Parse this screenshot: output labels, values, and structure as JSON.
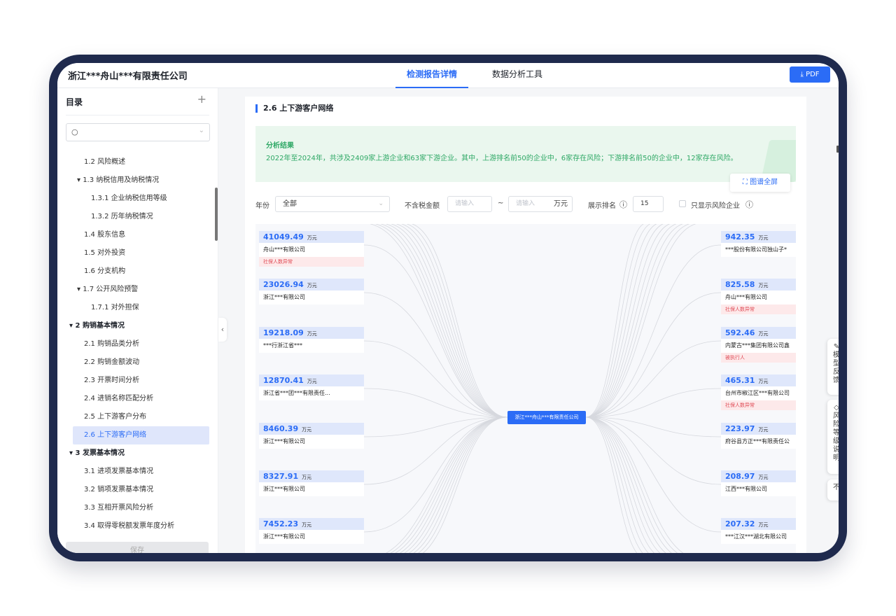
{
  "header": {
    "company": "浙江***舟山***有限责任公司",
    "tabs": [
      {
        "label": "检测报告详情",
        "active": true
      },
      {
        "label": "数据分析工具",
        "active": false
      }
    ],
    "pdf_label": "PDF"
  },
  "sidebar": {
    "title": "目录",
    "add_icon": "+",
    "items": [
      {
        "label": "1.2 风险概述"
      },
      {
        "label": "▾ 1.3 纳税信用及纳税情况"
      },
      {
        "label": "1.3.1 企业纳税信用等级"
      },
      {
        "label": "1.3.2 历年纳税情况"
      },
      {
        "label": "1.4 股东信息"
      },
      {
        "label": "1.5 对外投资"
      },
      {
        "label": "1.6 分支机构"
      },
      {
        "label": "▾ 1.7 公开风险预警"
      },
      {
        "label": "1.7.1 对外担保"
      },
      {
        "label": "▾ 2 购销基本情况"
      },
      {
        "label": "2.1 购销品类分析"
      },
      {
        "label": "2.2 购销金额波动"
      },
      {
        "label": "2.3 开票时间分析"
      },
      {
        "label": "2.4 进销名称匹配分析"
      },
      {
        "label": "2.5 上下游客户分布"
      },
      {
        "label": "2.6 上下游客户网络"
      },
      {
        "label": "▾ 3 发票基本情况"
      },
      {
        "label": "3.1 进项发票基本情况"
      },
      {
        "label": "3.2 销项发票基本情况"
      },
      {
        "label": "3.3 互相开票风险分析"
      },
      {
        "label": "3.4 取得零税额发票年度分析"
      }
    ],
    "save_label": "保存"
  },
  "section": {
    "title": "2.6 上下游客户网络",
    "result_title": "分析结果",
    "result_text": "2022年至2024年，共涉及2409家上游企业和63家下游企业。其中，上游排名前50的企业中，6家存在风险；下游排名前50的企业中，12家存在风险。",
    "fullscreen_label": "图谱全屏"
  },
  "filters": {
    "year_label": "年份",
    "year_value": "全部",
    "amount_label": "不含税金额",
    "min_placeholder": "请输入",
    "tilde": "~",
    "max_placeholder": "请输入",
    "unit": "万元",
    "rank_label": "展示排名",
    "rank_value": "15",
    "risk_only_label": "只显示风险企业"
  },
  "network": {
    "center": "浙江***舟山***有限责任公司",
    "unit": "万元",
    "upstream": [
      {
        "amount": "41049.49",
        "name": "舟山***有限公司",
        "tag": "社保人数异常"
      },
      {
        "amount": "23026.94",
        "name": "浙江***有限公司",
        "tag": ""
      },
      {
        "amount": "19218.09",
        "name": "***行浙江省***",
        "tag": ""
      },
      {
        "amount": "12870.41",
        "name": "浙江省***团***有限责任...",
        "tag": ""
      },
      {
        "amount": "8460.39",
        "name": "浙江***有限公司",
        "tag": ""
      },
      {
        "amount": "8327.91",
        "name": "浙江***有限公司",
        "tag": ""
      },
      {
        "amount": "7452.23",
        "name": "浙江***有限公司",
        "tag": ""
      }
    ],
    "downstream": [
      {
        "amount": "942.35",
        "name": "***股份有限公司独山子*",
        "tag": ""
      },
      {
        "amount": "825.58",
        "name": "舟山***有限公司",
        "tag": "社保人数异常"
      },
      {
        "amount": "592.46",
        "name": "内蒙古***集团有限公司鑫",
        "tag": "被执行人"
      },
      {
        "amount": "465.31",
        "name": "台州市椒江区***有限公司",
        "tag": "社保人数异常"
      },
      {
        "amount": "223.97",
        "name": "府谷县方正***有限责任公",
        "tag": ""
      },
      {
        "amount": "208.97",
        "name": "江西***有限公司",
        "tag": ""
      },
      {
        "amount": "207.32",
        "name": "***江汉***湖北有限公司",
        "tag": ""
      }
    ]
  },
  "float_tools": {
    "feedback": [
      "模",
      "型",
      "反",
      "馈"
    ],
    "risk_explain": [
      "风",
      "险",
      "等",
      "级",
      "说",
      "明"
    ],
    "top": "不"
  }
}
